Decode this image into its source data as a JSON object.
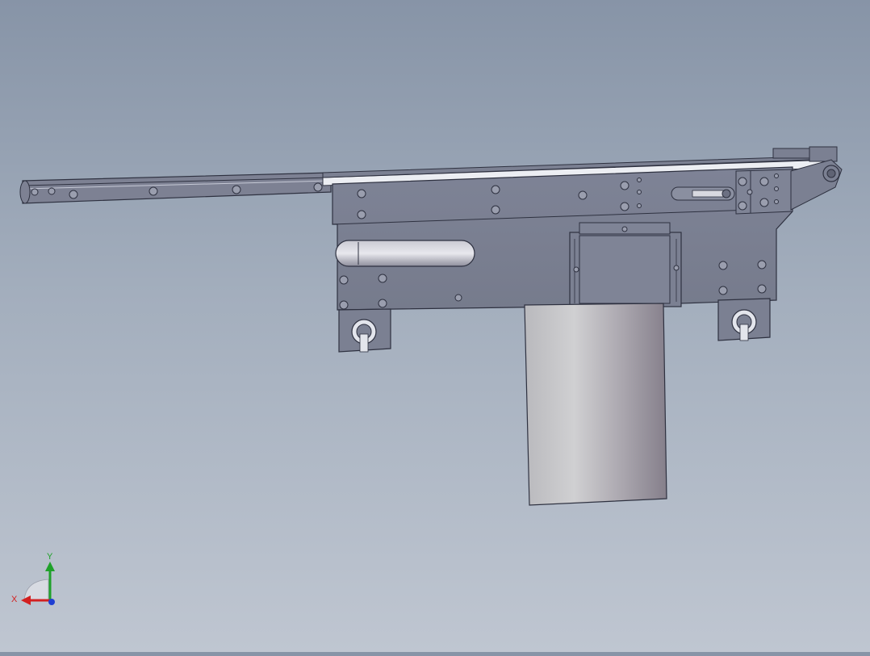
{
  "viewport": {
    "background_top": "#8794a7",
    "background_bottom": "#bfc6d1"
  },
  "model": {
    "frame_color": "#7b8092",
    "edge_color": "#2e3140",
    "cylinder_light": "#c9c9cb",
    "cylinder_dark": "#8a8590"
  },
  "triad": {
    "x_label": "X",
    "y_label": "Y",
    "x_color": "#d32020",
    "y_color": "#1fa12a",
    "z_color": "#1f3fd3"
  }
}
